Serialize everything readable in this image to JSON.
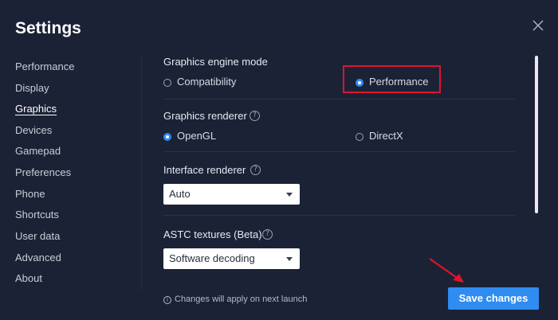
{
  "window": {
    "title": "Settings"
  },
  "sidebar": {
    "items": [
      {
        "label": "Performance"
      },
      {
        "label": "Display"
      },
      {
        "label": "Graphics"
      },
      {
        "label": "Devices"
      },
      {
        "label": "Gamepad"
      },
      {
        "label": "Preferences"
      },
      {
        "label": "Phone"
      },
      {
        "label": "Shortcuts"
      },
      {
        "label": "User data"
      },
      {
        "label": "Advanced"
      },
      {
        "label": "About"
      }
    ],
    "active": "Graphics"
  },
  "graphics_engine": {
    "label": "Graphics engine mode",
    "options": [
      {
        "label": "Compatibility",
        "selected": false
      },
      {
        "label": "Performance",
        "selected": true
      }
    ]
  },
  "graphics_renderer": {
    "label": "Graphics renderer",
    "options": [
      {
        "label": "OpenGL",
        "selected": true
      },
      {
        "label": "DirectX",
        "selected": false
      }
    ]
  },
  "interface_renderer": {
    "label": "Interface renderer",
    "value": "Auto"
  },
  "astc_textures": {
    "label": "ASTC textures (Beta)",
    "value": "Software decoding"
  },
  "footer": {
    "note": "Changes will apply on next launch",
    "save_label": "Save changes"
  },
  "colors": {
    "background": "#1c2236",
    "accent": "#2f8cf0",
    "highlight": "#e0142a"
  },
  "icons": {
    "close": "close-icon",
    "help": "question-circle-icon",
    "info": "info-circle-icon",
    "caret": "caret-down-icon",
    "annotation": "red-arrow-icon"
  }
}
